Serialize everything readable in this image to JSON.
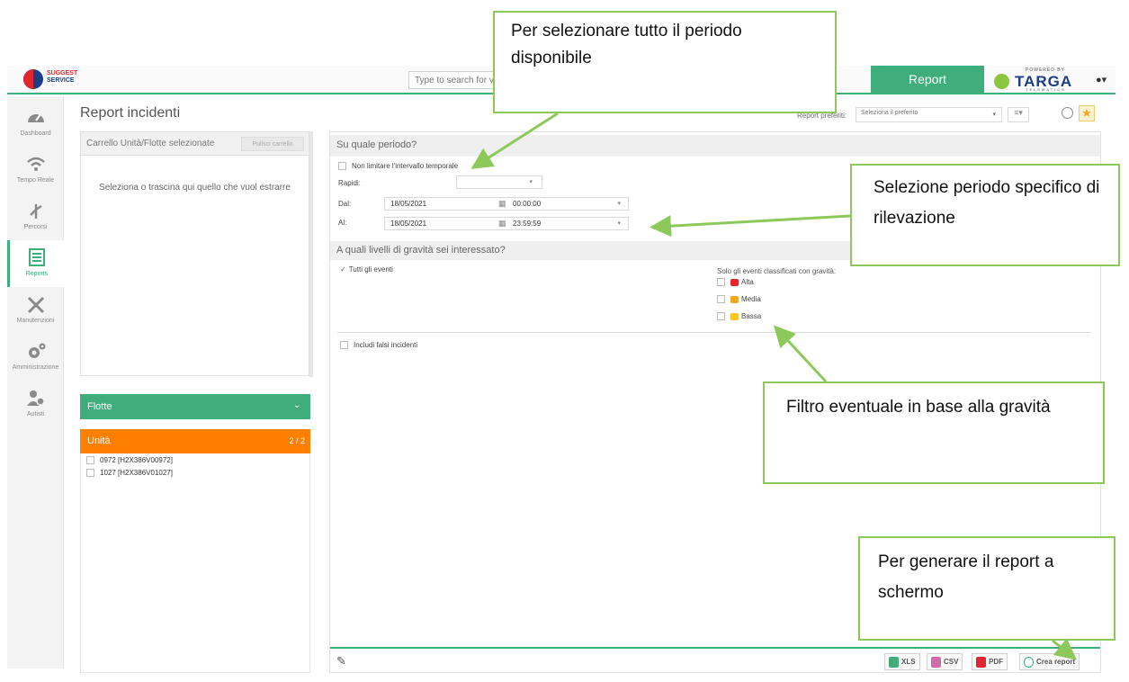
{
  "header": {
    "logo_line1": "SUGGEST",
    "logo_line2": "SERVICE",
    "search_placeholder": "Type to search for v",
    "active_tab": "Report",
    "brand_powered": "POWERED BY",
    "brand_name": "TARGA",
    "brand_sub": "TELEMATICS",
    "accent_color": "#3fae7a"
  },
  "sidebar": {
    "items": [
      {
        "label": "Dashboard",
        "icon": "speedometer-icon"
      },
      {
        "label": "Tempo Reale",
        "icon": "wifi-icon"
      },
      {
        "label": "Percorsi",
        "icon": "route-icon"
      },
      {
        "label": "Reports",
        "icon": "report-sheet-icon"
      },
      {
        "label": "Manutenzioni",
        "icon": "tools-icon"
      },
      {
        "label": "Amministrazione",
        "icon": "gears-icon"
      },
      {
        "label": "Autisti",
        "icon": "drivers-icon"
      }
    ],
    "active": "Reports"
  },
  "page": {
    "title": "Report incidenti",
    "favorites_label": "Report preferiti:",
    "favorites_placeholder": "Seleziona il preferito"
  },
  "cart": {
    "title": "Carrello Unità/Flotte selezionate",
    "clear_button": "Pulisci carrello",
    "placeholder": "Seleziona o trascina qui quello che vuol estrarre"
  },
  "fleets": {
    "label": "Flotte",
    "color": "#3fae7a"
  },
  "units": {
    "label": "Unità",
    "count": "2 / 2",
    "color": "#ff7f00",
    "items": [
      "0972 [H2X386V00972]",
      "1027 [H2X386V01027]"
    ]
  },
  "period": {
    "heading": "Su quale periodo?",
    "no_limit_label": "Non limitare l'intervallo temporale",
    "quick_label": "Rapidi:",
    "from_label": "Dal:",
    "to_label": "Al:",
    "from_date": "18/05/2021",
    "from_time": "00:00:00",
    "to_date": "18/05/2021",
    "to_time": "23:59:59"
  },
  "severity": {
    "heading": "A quali livelli di gravità sei interessato?",
    "all_events_label": "Tutti gli eventi",
    "classified_label": "Solo gli eventi classificati con gravità:",
    "levels": [
      {
        "label": "Alta",
        "color": "#e3262d"
      },
      {
        "label": "Media",
        "color": "#f5a623"
      },
      {
        "label": "Bassa",
        "color": "#f5c523"
      }
    ],
    "false_incidents_label": "Includi falsi incidenti"
  },
  "footer": {
    "xls": "XLS",
    "csv": "CSV",
    "pdf": "PDF",
    "create": "Crea report"
  },
  "callouts": {
    "period_all": "Per selezionare tutto il periodo disponibile",
    "period_specific": "Selezione periodo specifico di rilevazione",
    "severity_filter": "Filtro eventuale in base alla gravità",
    "generate": "Per generare il report a schermo"
  }
}
